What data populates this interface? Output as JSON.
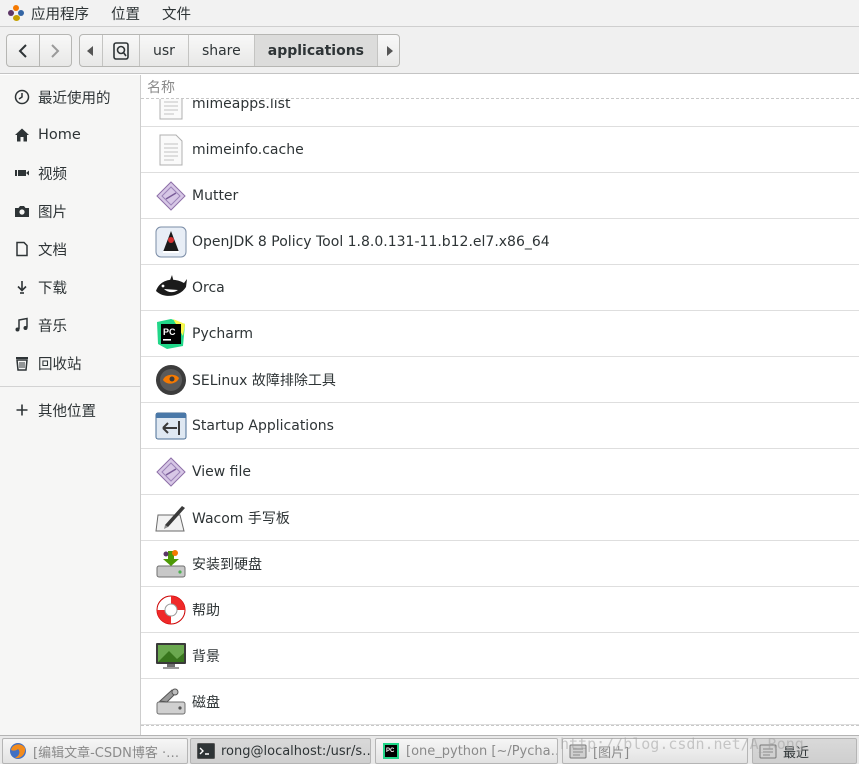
{
  "menubar": {
    "items": [
      "应用程序",
      "位置",
      "文件"
    ]
  },
  "pathbar": {
    "crumbs": [
      "usr",
      "share",
      "applications"
    ]
  },
  "sidebar": {
    "items": [
      "最近使用的",
      "Home",
      "视频",
      "图片",
      "文档",
      "下载",
      "音乐",
      "回收站"
    ],
    "other_places": "其他位置"
  },
  "filelist": {
    "column_header": "名称",
    "files": [
      {
        "name": "mimeapps.list",
        "icon": "text-file-icon"
      },
      {
        "name": "mimeinfo.cache",
        "icon": "text-file-icon"
      },
      {
        "name": "Mutter",
        "icon": "generic-app-icon"
      },
      {
        "name": "OpenJDK 8 Policy Tool 1.8.0.131-11.b12.el7.x86_64",
        "icon": "java-duke-icon"
      },
      {
        "name": "Orca",
        "icon": "orca-whale-icon"
      },
      {
        "name": "Pycharm",
        "icon": "pycharm-icon"
      },
      {
        "name": "SELinux 故障排除工具",
        "icon": "selinux-icon"
      },
      {
        "name": "Startup Applications",
        "icon": "startup-apps-icon"
      },
      {
        "name": "View file",
        "icon": "generic-app-icon"
      },
      {
        "name": "Wacom 手写板",
        "icon": "tablet-pen-icon"
      },
      {
        "name": "安装到硬盘",
        "icon": "install-disk-icon"
      },
      {
        "name": "帮助",
        "icon": "help-lifebuoy-icon"
      },
      {
        "name": "背景",
        "icon": "wallpaper-monitor-icon"
      },
      {
        "name": "磁盘",
        "icon": "disk-utility-icon"
      }
    ]
  },
  "taskbar": {
    "tasks": [
      {
        "label": "[编辑文章-CSDN博客 ·…",
        "icon": "firefox-icon"
      },
      {
        "label": "rong@localhost:/usr/s…",
        "icon": "terminal-icon"
      },
      {
        "label": "[one_python [~/Pycha…",
        "icon": "pycharm-icon"
      },
      {
        "label": "[图片]",
        "icon": "files-icon"
      },
      {
        "label": "最近",
        "icon": "files-icon"
      }
    ],
    "watermark": "http://blog.csdn.net/A_Rong"
  },
  "colors": {
    "sidebar_bg": "#f6f6f5",
    "active_crumb": "#dcdcdb",
    "row_divider": "#dedede"
  }
}
